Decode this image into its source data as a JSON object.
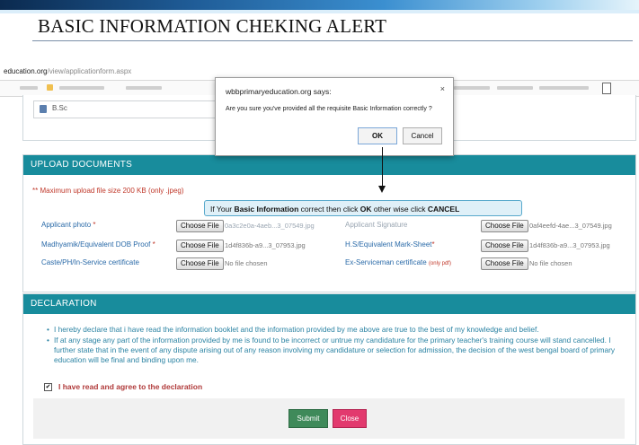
{
  "slide": {
    "title": "BASIC INFORMATION CHEKING ALERT"
  },
  "browser": {
    "url_host": "education.org",
    "url_path": "/view/applicationform.aspx"
  },
  "education": {
    "value": "B.Sc"
  },
  "upload": {
    "header": "UPLOAD DOCUMENTS",
    "max_note": "** Maximum upload file size 200 KB (only .jpeg)",
    "choose_label": "Choose File",
    "rows": [
      {
        "label": "Applicant photo",
        "req": "*",
        "file": "0a3c2e0a-4aeb...3_07549.jpg"
      },
      {
        "label": "Applicant Signature",
        "req": "",
        "file": "0af4eefd-4ae...3_07549.jpg"
      },
      {
        "label": "Madhyamik/Equivalent DOB Proof",
        "req": "*",
        "file": "1d4f836b-a9...3_07953.jpg"
      },
      {
        "label": "H.S/Equivalent Mark-Sheet",
        "req": "*",
        "file": "1d4f836b-a9...3_07953.jpg"
      },
      {
        "label": "Caste/PH/In-Service certificate",
        "req": "",
        "file": "No file chosen"
      },
      {
        "label": "Ex-Serviceman certificate",
        "note": "(only pdf)",
        "file": "No file chosen"
      }
    ]
  },
  "declaration": {
    "header": "DECLARATION",
    "items": [
      "I hereby declare that i have read the information booklet and the information provided by me above are true to the best of my knowledge and belief.",
      "If at any stage any part of the information provided by me is found to be incorrect or untrue my candidature for the primary teacher's training course will stand cancelled. I further state that in the event of any dispute arising out of any reason involving my candidature or selection for admission, the decision of the west bengal board of primary education will be final and binding upon me."
    ],
    "agree_label": "I have read and agree to the declaration",
    "agree_mark": "✔",
    "submit_label": "Submit",
    "close_label": "Close"
  },
  "dialog": {
    "title": "wbbprimaryeducation.org says:",
    "message": "Are you sure you've provided all the requisite Basic Information correctly ?",
    "ok_label": "OK",
    "cancel_label": "Cancel",
    "close_glyph": "×"
  },
  "callout": {
    "part1": "If Your ",
    "bold1": "Basic Information",
    "part2": " correct then click ",
    "bold2": "OK",
    "part3": " other wise click ",
    "bold3": "CANCEL"
  }
}
